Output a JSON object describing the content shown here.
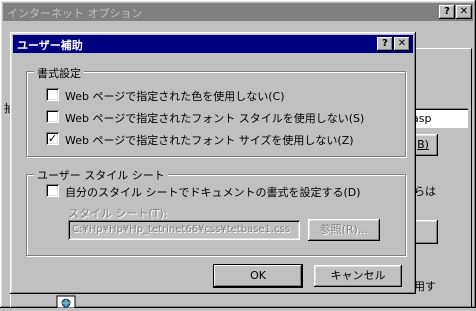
{
  "background_window": {
    "title": "インターネット オプション",
    "help_btn": "?",
    "close_btn": "✕",
    "partial_left_char": "抽",
    "partial_field_text": "asp",
    "partial_button_text": "B)",
    "partial_text_1": "らは",
    "partial_text_2": "用す"
  },
  "dialog": {
    "title": "ユーザー補助",
    "help_btn": "?",
    "close_btn": "✕",
    "formatting": {
      "legend": "書式設定",
      "options": [
        {
          "label": "Web ページで指定された色を使用しない(C)",
          "checked": false
        },
        {
          "label": "Web ページで指定されたフォント スタイルを使用しない(S)",
          "checked": false
        },
        {
          "label": "Web ページで指定されたフォント サイズを使用しない(Z)",
          "checked": true
        }
      ]
    },
    "user_style": {
      "legend": "ユーザー スタイル シート",
      "option_label": "自分のスタイル シートでドキュメントの書式を設定する(D)",
      "option_checked": false,
      "sheet_label": "スタイル シート(T):",
      "sheet_path": "C:¥Hp¥Hp¥Hp_tetrinet66¥css¥tetbase1.css",
      "browse_label": "参照(R)..."
    },
    "ok_label": "OK",
    "cancel_label": "キャンセル"
  }
}
